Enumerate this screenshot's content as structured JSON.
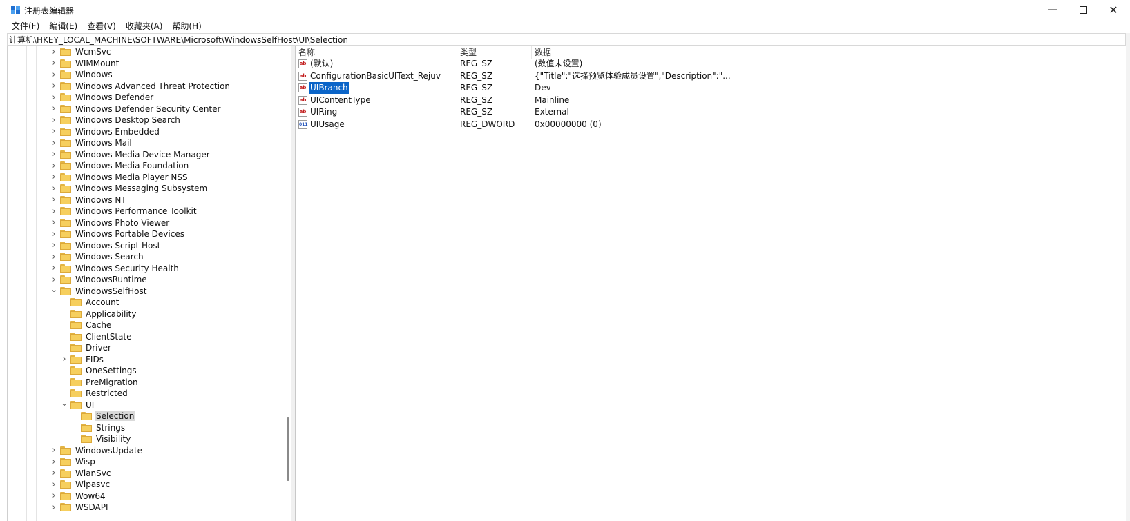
{
  "window": {
    "title": "注册表编辑器"
  },
  "window_controls": {
    "minimize": "—",
    "maximize": "",
    "close": "✕"
  },
  "menu": [
    "文件(F)",
    "编辑(E)",
    "查看(V)",
    "收藏夹(A)",
    "帮助(H)"
  ],
  "address": "计算机\\HKEY_LOCAL_MACHINE\\SOFTWARE\\Microsoft\\WindowsSelfHost\\UI\\Selection",
  "tree": [
    {
      "label": "WcmSvc",
      "level": 0,
      "expander": "collapsed"
    },
    {
      "label": "WIMMount",
      "level": 0,
      "expander": "collapsed"
    },
    {
      "label": "Windows",
      "level": 0,
      "expander": "collapsed"
    },
    {
      "label": "Windows Advanced Threat Protection",
      "level": 0,
      "expander": "collapsed"
    },
    {
      "label": "Windows Defender",
      "level": 0,
      "expander": "collapsed"
    },
    {
      "label": "Windows Defender Security Center",
      "level": 0,
      "expander": "collapsed"
    },
    {
      "label": "Windows Desktop Search",
      "level": 0,
      "expander": "collapsed"
    },
    {
      "label": "Windows Embedded",
      "level": 0,
      "expander": "collapsed"
    },
    {
      "label": "Windows Mail",
      "level": 0,
      "expander": "collapsed"
    },
    {
      "label": "Windows Media Device Manager",
      "level": 0,
      "expander": "collapsed"
    },
    {
      "label": "Windows Media Foundation",
      "level": 0,
      "expander": "collapsed"
    },
    {
      "label": "Windows Media Player NSS",
      "level": 0,
      "expander": "collapsed"
    },
    {
      "label": "Windows Messaging Subsystem",
      "level": 0,
      "expander": "collapsed"
    },
    {
      "label": "Windows NT",
      "level": 0,
      "expander": "collapsed"
    },
    {
      "label": "Windows Performance Toolkit",
      "level": 0,
      "expander": "collapsed"
    },
    {
      "label": "Windows Photo Viewer",
      "level": 0,
      "expander": "collapsed"
    },
    {
      "label": "Windows Portable Devices",
      "level": 0,
      "expander": "collapsed"
    },
    {
      "label": "Windows Script Host",
      "level": 0,
      "expander": "collapsed"
    },
    {
      "label": "Windows Search",
      "level": 0,
      "expander": "collapsed"
    },
    {
      "label": "Windows Security Health",
      "level": 0,
      "expander": "collapsed"
    },
    {
      "label": "WindowsRuntime",
      "level": 0,
      "expander": "collapsed"
    },
    {
      "label": "WindowsSelfHost",
      "level": 0,
      "expander": "expanded"
    },
    {
      "label": "Account",
      "level": 1,
      "expander": "none"
    },
    {
      "label": "Applicability",
      "level": 1,
      "expander": "none"
    },
    {
      "label": "Cache",
      "level": 1,
      "expander": "none"
    },
    {
      "label": "ClientState",
      "level": 1,
      "expander": "none"
    },
    {
      "label": "Driver",
      "level": 1,
      "expander": "none"
    },
    {
      "label": "FIDs",
      "level": 1,
      "expander": "collapsed"
    },
    {
      "label": "OneSettings",
      "level": 1,
      "expander": "none"
    },
    {
      "label": "PreMigration",
      "level": 1,
      "expander": "none"
    },
    {
      "label": "Restricted",
      "level": 1,
      "expander": "none"
    },
    {
      "label": "UI",
      "level": 1,
      "expander": "expanded"
    },
    {
      "label": "Selection",
      "level": 2,
      "expander": "none",
      "selected": true
    },
    {
      "label": "Strings",
      "level": 2,
      "expander": "none"
    },
    {
      "label": "Visibility",
      "level": 2,
      "expander": "none"
    },
    {
      "label": "WindowsUpdate",
      "level": 0,
      "expander": "collapsed"
    },
    {
      "label": "Wisp",
      "level": 0,
      "expander": "collapsed"
    },
    {
      "label": "WlanSvc",
      "level": 0,
      "expander": "collapsed"
    },
    {
      "label": "Wlpasvc",
      "level": 0,
      "expander": "collapsed"
    },
    {
      "label": "Wow64",
      "level": 0,
      "expander": "collapsed"
    },
    {
      "label": "WSDAPI",
      "level": 0,
      "expander": "collapsed"
    }
  ],
  "list": {
    "columns": [
      "名称",
      "类型",
      "数据"
    ],
    "rows": [
      {
        "name": "(默认)",
        "type": "REG_SZ",
        "data": "(数值未设置)",
        "icon": "string-value-icon",
        "glyph": "ab"
      },
      {
        "name": "ConfigurationBasicUIText_Rejuv",
        "type": "REG_SZ",
        "data": "{\"Title\":\"选择预览体验成员设置\",\"Description\":\"...",
        "icon": "string-value-icon",
        "glyph": "ab"
      },
      {
        "name": "UIBranch",
        "type": "REG_SZ",
        "data": "Dev",
        "icon": "string-value-icon",
        "glyph": "ab",
        "selected": true
      },
      {
        "name": "UIContentType",
        "type": "REG_SZ",
        "data": "Mainline",
        "icon": "string-value-icon",
        "glyph": "ab"
      },
      {
        "name": "UIRing",
        "type": "REG_SZ",
        "data": "External",
        "icon": "string-value-icon",
        "glyph": "ab"
      },
      {
        "name": "UIUsage",
        "type": "REG_DWORD",
        "data": "0x00000000 (0)",
        "icon": "binary-value-icon",
        "glyph": "011"
      }
    ]
  },
  "colors": {
    "selection": "#0a64c8",
    "tree_selection": "#d9d9d9",
    "folder": "#f6cf5e",
    "desktop": "#1f4fa8"
  }
}
